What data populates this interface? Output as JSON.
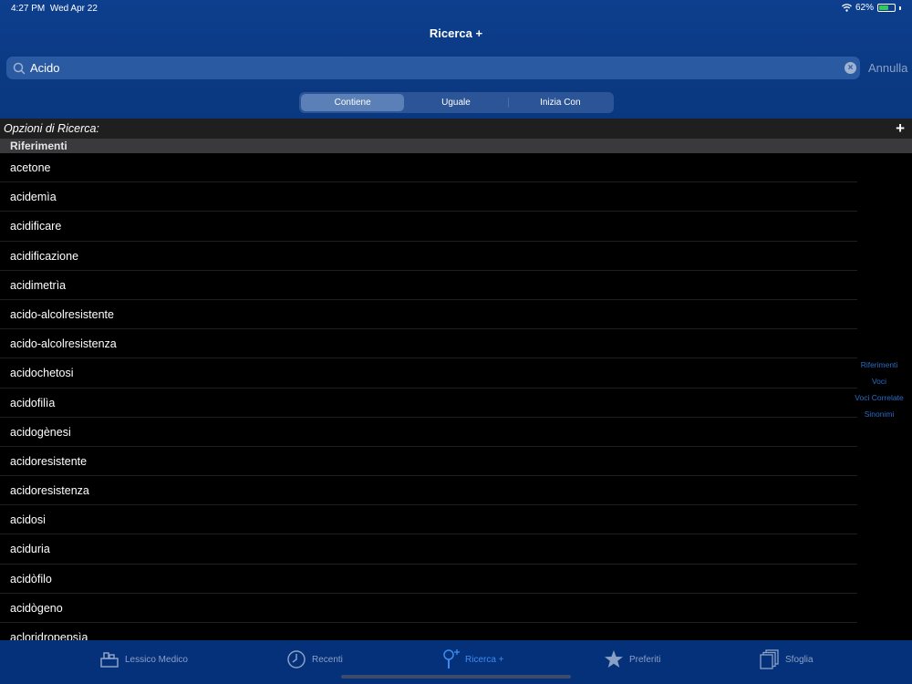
{
  "status": {
    "time": "4:27 PM",
    "date": "Wed Apr 22",
    "battery_text": "62%",
    "battery_level": 0.62
  },
  "nav": {
    "title": "Ricerca +"
  },
  "search": {
    "value": "Acido",
    "cancel_label": "Annulla"
  },
  "segments": {
    "items": [
      "Contiene",
      "Uguale",
      "Inizia Con"
    ],
    "selected": "Contiene"
  },
  "options": {
    "label": "Opzioni di Ricerca:",
    "add_label": "+"
  },
  "section": {
    "title": "Riferimenti"
  },
  "results": [
    "acetone",
    "acidemìa",
    "acidificare",
    "acidificazione",
    "acidimetrìa",
    "acido-alcolresistente",
    "acido-alcolresistenza",
    "acidochetosi",
    "acidofilìa",
    "acidogènesi",
    "acidoresistente",
    "acidoresistenza",
    "acidosi",
    "aciduria",
    "acidòfilo",
    "acidògeno",
    "acloridropepsìa"
  ],
  "index": [
    "Riferimenti",
    "Voci",
    "Voci Correlate",
    "Sinonimi"
  ],
  "tabs": [
    {
      "label": "Lessico Medico",
      "icon": "books-icon"
    },
    {
      "label": "Recenti",
      "icon": "clock-icon"
    },
    {
      "label": "Ricerca +",
      "icon": "search-plus-icon",
      "active": true
    },
    {
      "label": "Preferiti",
      "icon": "star-icon"
    },
    {
      "label": "Sfoglia",
      "icon": "pages-icon"
    }
  ],
  "colors": {
    "header": "#0b3a84",
    "tabbar": "#05307a",
    "accent": "#3c8cf0",
    "index": "#2a6cc4"
  }
}
